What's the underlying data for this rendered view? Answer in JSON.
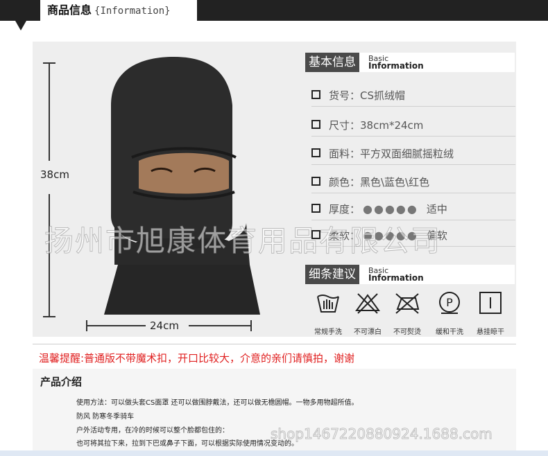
{
  "header": {
    "title_cn": "商品信息",
    "title_en": "{Information}"
  },
  "product_image": {
    "alt": "balaclava-photo",
    "height_label": "38cm",
    "width_label": "24cm"
  },
  "basic_info": {
    "title_cn": "基本信息",
    "title_en_1": "Basic",
    "title_en_2": "Information",
    "rows": [
      {
        "text": "货号：CS抓绒帽"
      },
      {
        "text": "尺寸：38cm*24cm"
      },
      {
        "text": "面料：平方双面细腻摇粒绒"
      },
      {
        "text": "颜色：黑色\\蓝色\\红色"
      },
      {
        "label": "厚度：",
        "dots": "●●●●●",
        "note": "适中"
      },
      {
        "label": "柔软：",
        "dots": "●●●●●",
        "note": "偏软"
      }
    ]
  },
  "care": {
    "title_cn": "细条建议",
    "title_en_1": "Basic",
    "title_en_2": "Information",
    "items": [
      {
        "icon": "hand-wash-icon",
        "label": "常规手洗"
      },
      {
        "icon": "no-bleach-icon",
        "label": "不可漂白"
      },
      {
        "icon": "no-iron-icon",
        "label": "不可熨烫"
      },
      {
        "icon": "dry-clean-icon",
        "label": "缓和干洗"
      },
      {
        "icon": "hang-dry-icon",
        "label": "悬挂晾干"
      }
    ]
  },
  "watermark": "扬州市旭康体育用品有限公司",
  "warning": "温馨提醒:普通版不带魔术扣，开口比较大，介意的亲们请慎拍，谢谢",
  "intro": {
    "title": "产品介绍",
    "lines": [
      "使用方法：可以做头套CS面罩  还可以做围脖戴法，还可以做无檐圆帽。一物多用物超所值。",
      "防风  防寒冬季骑车",
      "户外活动专用，在冷的时候可以整个脸都包住的：",
      "也可将其拉下来，拉到下巴或鼻子下面，可以根据实际使用情况变动的。"
    ]
  },
  "shop_watermark": "shop1467220880924.1688.com",
  "colors": {
    "dark": "#222222",
    "panel": "#eeeeee",
    "warning": "#e02020"
  }
}
